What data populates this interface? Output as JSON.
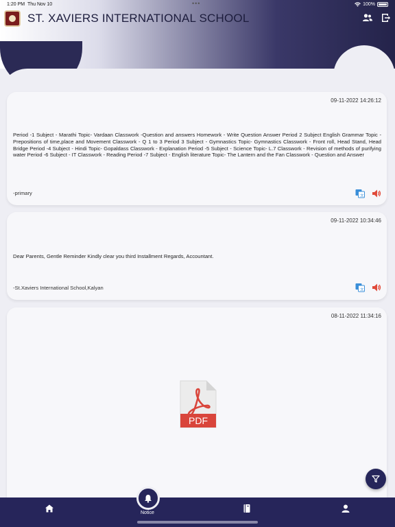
{
  "status_bar": {
    "time": "1:20 PM",
    "date": "Thu Nov 10",
    "dots": "•••",
    "battery": "100%"
  },
  "header": {
    "title": "ST. XAVIERS INTERNATIONAL SCHOOL",
    "icons": [
      "users-icon",
      "logout-icon"
    ]
  },
  "notices": [
    {
      "date": "09-11-2022 14:26:12",
      "body": "Period -1  Subject - Marathi  Topic- Vardaan  Classwork -Question and answers  Homework - Write Question Answer    Period 2  Subject English Grammar   Topic  -  Prepositions of time,place and Movement   Classwork - Q 1 to 3    Period 3  Subject - Gymnastics   Topic- Gymnastics Classwork - Front roll, Head Stand, Head Bridge    Period -4   Subject - Hindi  Topic- Gopaldass  Classwork - Explanation    Period -5  Subject - Science  Topic- L.7  Classwork - Revision of methods of purifying water    Period -6   Subject - IT  Classwork - Reading   Period -7   Subject - English literature   Topic- The Lantern and the Fan   Classwork - Question and Answer",
      "sender": "-primary"
    },
    {
      "date": "09-11-2022 10:34:46",
      "body": "Dear Parents,  Gentle Reminder  Kindly clear you third Installment  Regards,  Accountant.",
      "sender": "-St.Xaviers International School,Kalyan"
    },
    {
      "date": "08-11-2022 11:34:16",
      "attachment": "PDF"
    }
  ],
  "bottom_nav": {
    "items": [
      "home-icon",
      "notice-bell-icon",
      "book-icon",
      "profile-icon"
    ],
    "active_label": "Notice"
  },
  "colors": {
    "primary": "#26255a",
    "pdf_red": "#d9453b",
    "translate_blue": "#3b8fd9",
    "speaker_red": "#e04a3a"
  }
}
